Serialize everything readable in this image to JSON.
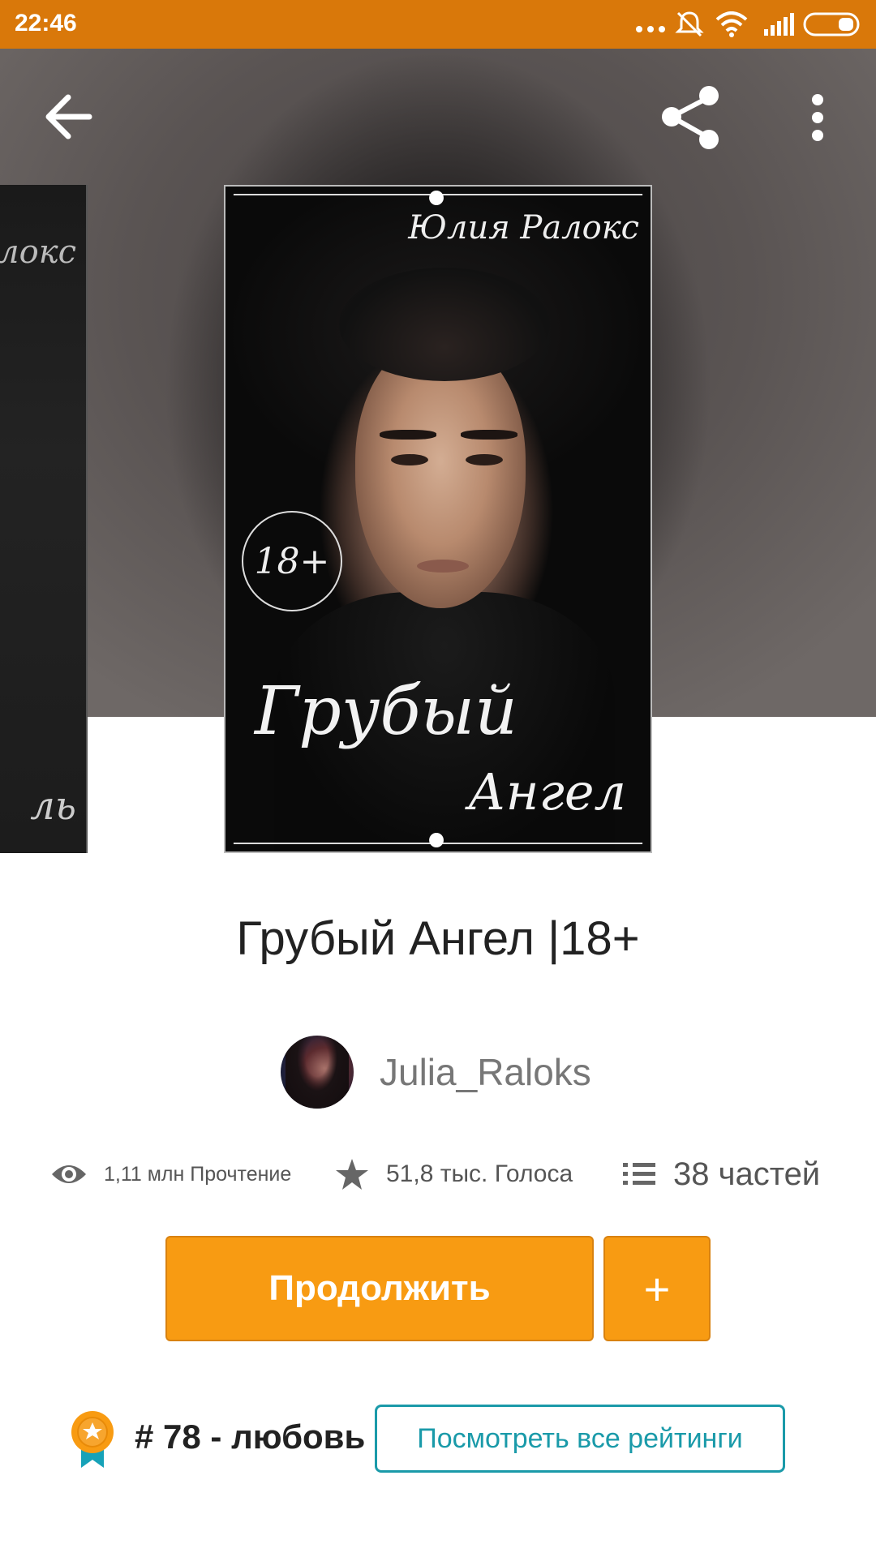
{
  "status_bar": {
    "time": "22:46",
    "icons": [
      "more-dots-icon",
      "vibrate-off-icon",
      "wifi-icon",
      "signal-icon",
      "battery-icon"
    ]
  },
  "toolbar": {
    "back_icon": "arrow-back-icon",
    "share_icon": "share-icon",
    "more_icon": "more-vert-icon"
  },
  "peek_cover": {
    "top_text": "локс",
    "bottom_text": "ль"
  },
  "cover": {
    "author": "Юлия Ралокс",
    "age_badge": "18+",
    "title_line1": "Грубый",
    "title_line2": "Ангел"
  },
  "book": {
    "title": "Грубый Ангел |18+",
    "author": "Julia_Raloks"
  },
  "stats": {
    "reads": "1,11 млн Прочтение",
    "votes": "51,8 тыс. Голоса",
    "parts": "38 частей"
  },
  "actions": {
    "continue_label": "Продолжить",
    "add_label": "+"
  },
  "ranking": {
    "text": "# 78 - любовь",
    "view_all_label": "Посмотреть все рейтинги"
  },
  "colors": {
    "status_bar": "#d9780a",
    "accent_orange": "#f89b12",
    "accent_teal": "#1a9aa9"
  }
}
